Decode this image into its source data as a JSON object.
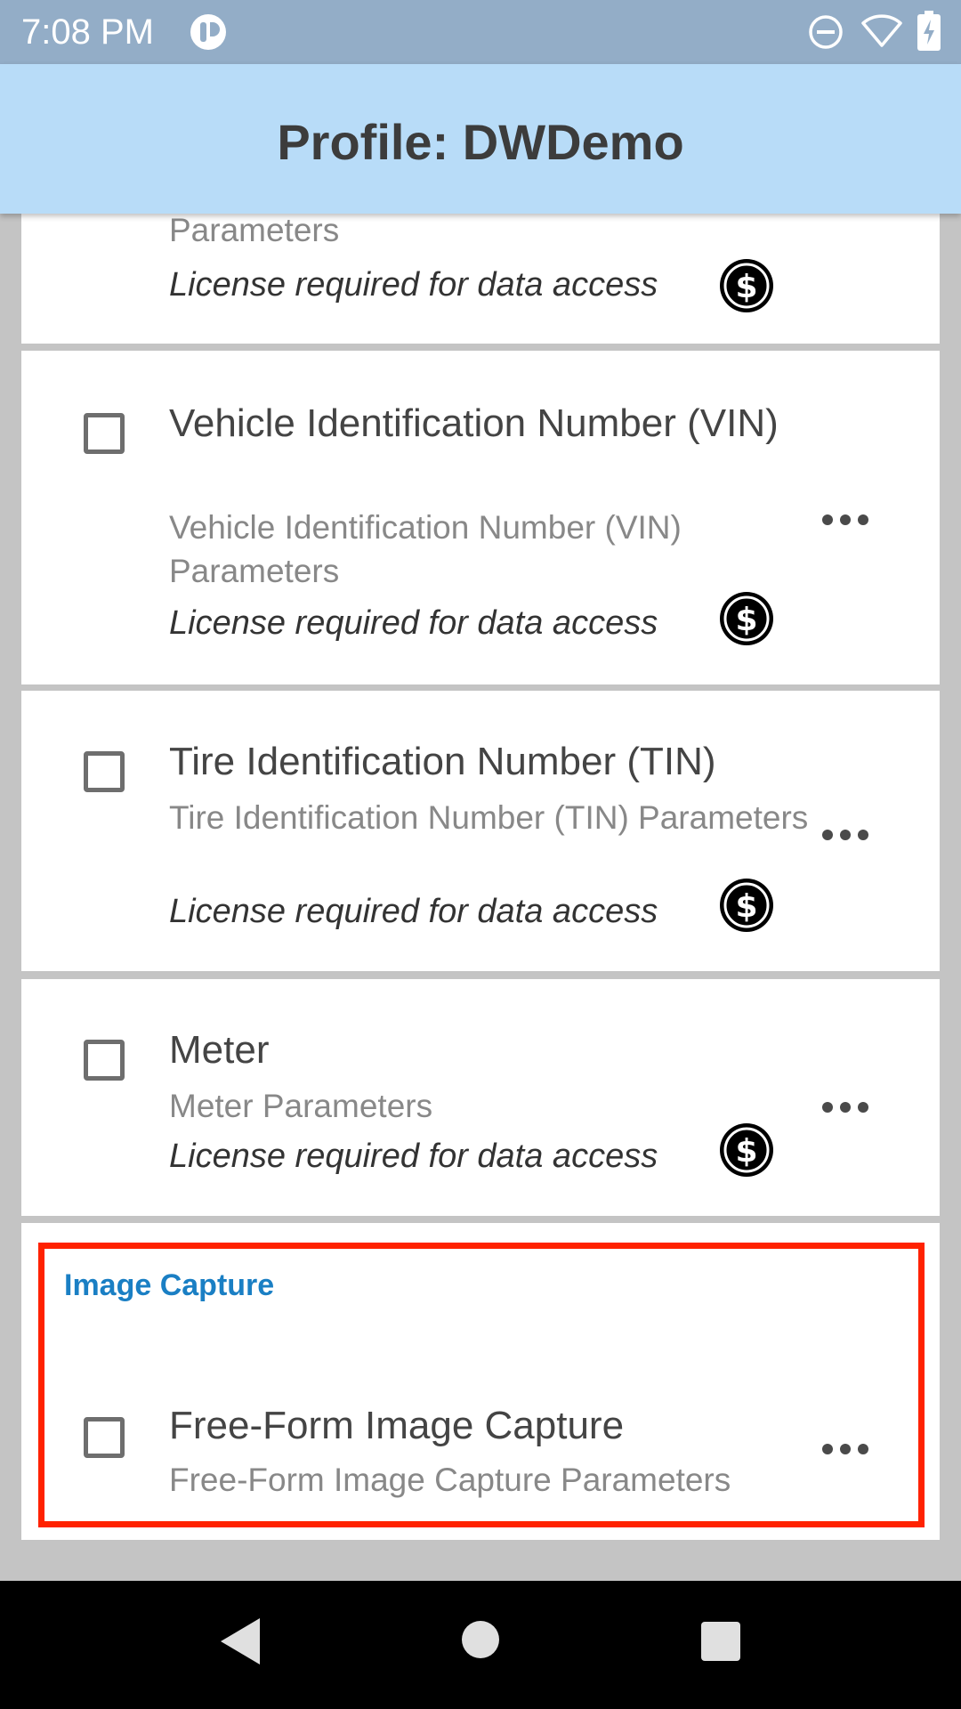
{
  "status_bar": {
    "time": "7:08 PM",
    "icons": [
      "notification-app-icon",
      "do-not-disturb-icon",
      "wifi-icon",
      "battery-charging-icon"
    ]
  },
  "app_bar": {
    "title": "Profile: DWDemo"
  },
  "top_partial_item": {
    "subtitle_fragment": "Parameters",
    "license": "License required for data access"
  },
  "items": [
    {
      "title": "Vehicle Identification Number (VIN)",
      "subtitle": "Vehicle Identification Number (VIN) Parameters",
      "license": "License required for data access",
      "checked": false
    },
    {
      "title": "Tire Identification Number (TIN)",
      "subtitle": "Tire Identification Number (TIN) Parameters",
      "license": "License required for data access",
      "checked": false
    },
    {
      "title": "Meter",
      "subtitle": "Meter Parameters",
      "license": "License required for data access",
      "checked": false
    }
  ],
  "image_capture_section": {
    "header": "Image Capture",
    "item": {
      "title": "Free-Form Image Capture",
      "subtitle": "Free-Form Image Capture Parameters",
      "checked": false
    }
  },
  "colors": {
    "status_bar": "#93adc7",
    "app_bar": "#b8dcf8",
    "section_header": "#1a7fc4",
    "highlight_border": "#ff2200",
    "background": "#c4c4c4"
  },
  "nav_bar": {
    "icons": [
      "back-icon",
      "home-icon",
      "recents-icon"
    ]
  }
}
